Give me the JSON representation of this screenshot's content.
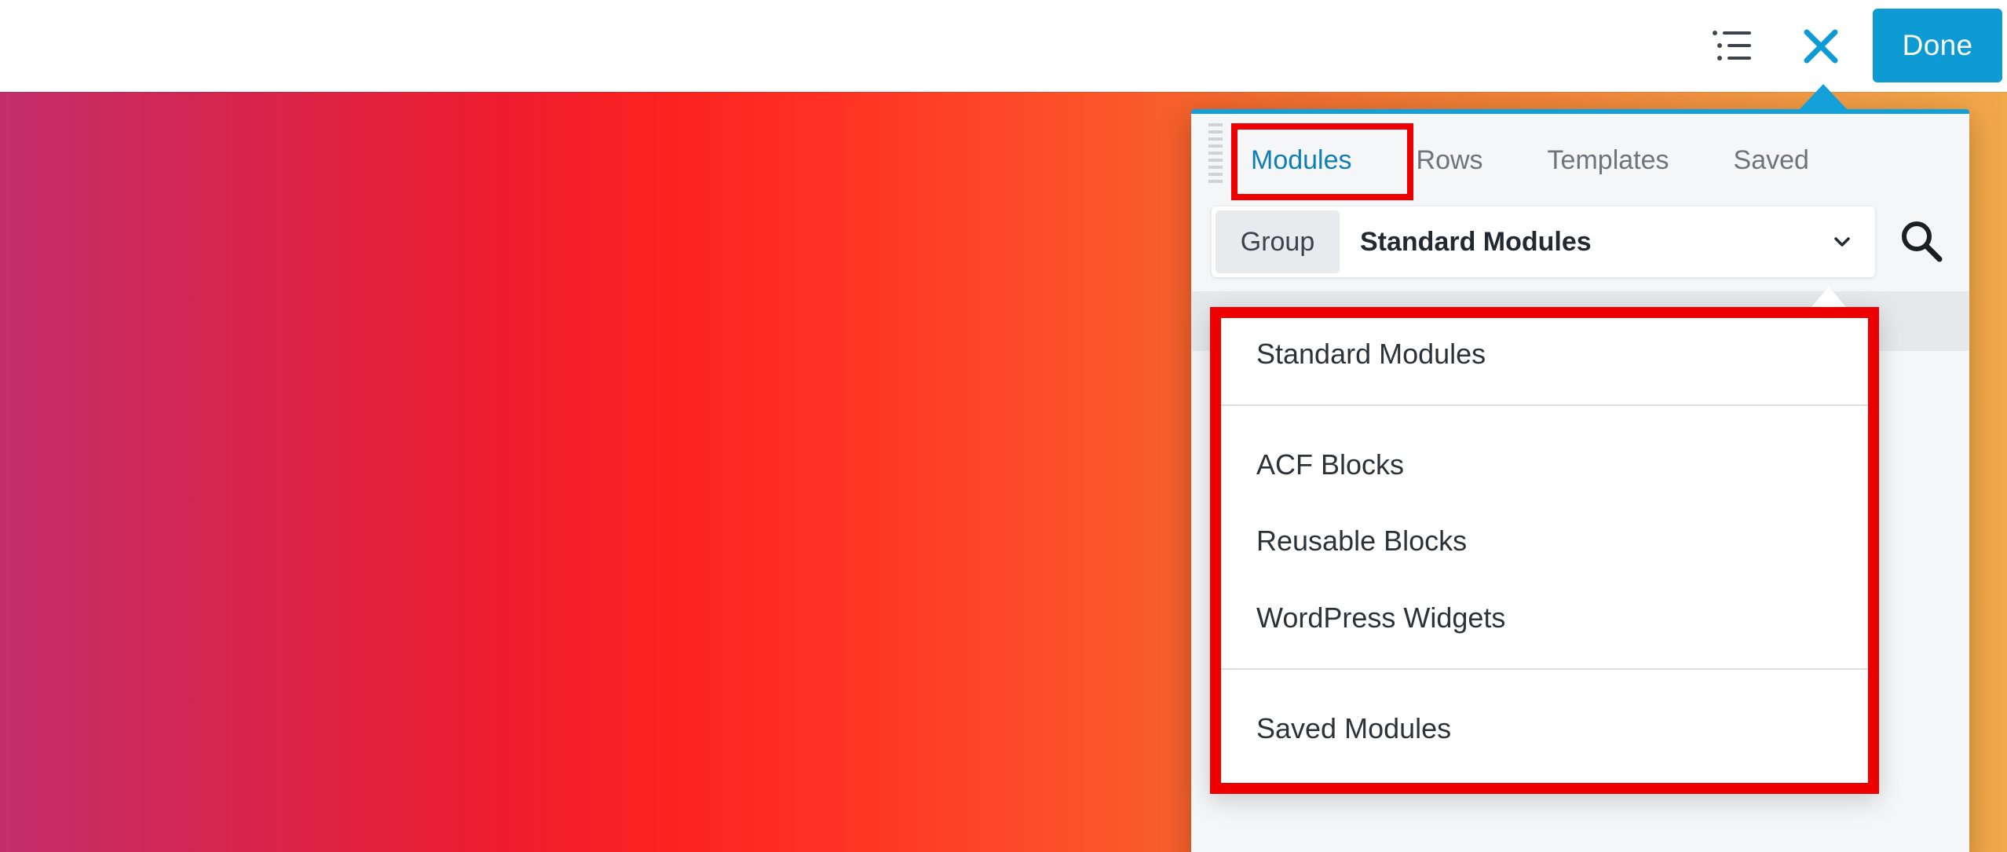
{
  "toolbar": {
    "done_label": "Done",
    "outline_icon": "outline-list-icon",
    "close_icon": "close-icon"
  },
  "panel": {
    "tabs": [
      {
        "label": "Modules",
        "active": true
      },
      {
        "label": "Rows",
        "active": false
      },
      {
        "label": "Templates",
        "active": false
      },
      {
        "label": "Saved",
        "active": false
      }
    ],
    "group": {
      "label": "Group",
      "selected": "Standard Modules"
    },
    "dropdown": {
      "items": [
        "Standard Modules",
        "ACF Blocks",
        "Reusable Blocks",
        "WordPress Widgets",
        "Saved Modules"
      ]
    }
  },
  "colors": {
    "accent": "#0e9bd4",
    "highlight": "#ee0000",
    "active_tab": "#0e7fb5"
  }
}
